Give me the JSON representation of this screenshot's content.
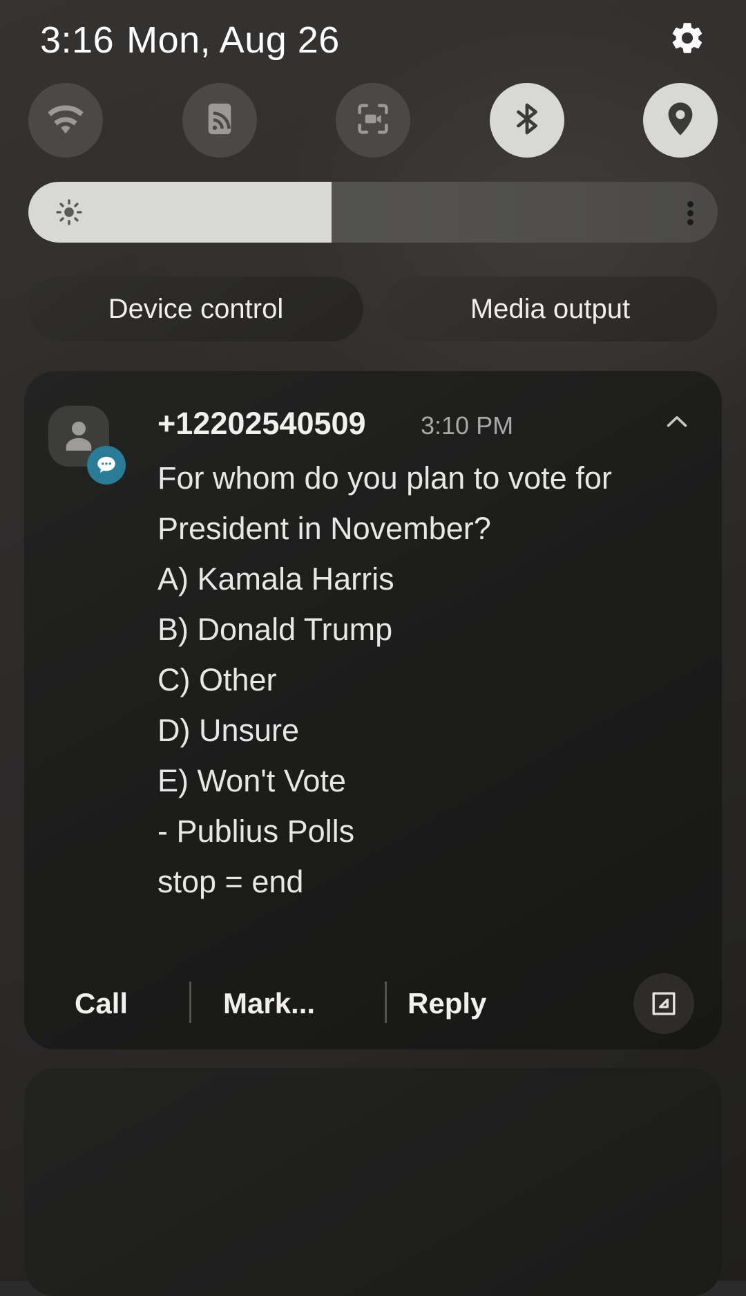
{
  "statusbar": {
    "time": "3:16",
    "date": "Mon, Aug 26",
    "settings_icon": "gear-icon"
  },
  "quick_settings": {
    "tiles": [
      {
        "name": "wifi",
        "icon": "wifi-icon",
        "state": "off"
      },
      {
        "name": "nfc",
        "icon": "nfc-icon",
        "state": "off"
      },
      {
        "name": "screencast",
        "icon": "screen-record-icon",
        "state": "off"
      },
      {
        "name": "bluetooth",
        "icon": "bluetooth-icon",
        "state": "on"
      },
      {
        "name": "location",
        "icon": "location-pin-icon",
        "state": "on"
      }
    ],
    "accent_on": "#d8d8d6",
    "accent_off": "#4a4947"
  },
  "brightness": {
    "icon": "brightness-icon",
    "value_percent": 44,
    "more_icon": "more-vertical-icon"
  },
  "shortcuts": {
    "device_control": "Device control",
    "media_output": "Media output"
  },
  "notification": {
    "avatar_icon": "person-avatar-icon",
    "badge_icon": "message-bubble-icon",
    "badge_color": "#2a7b96",
    "sender": "+12202540509",
    "timestamp": "3:10 PM",
    "collapse_icon": "chevron-up-icon",
    "message": "For whom do you plan to vote for President in November?\nA) Kamala Harris\nB) Donald Trump\nC) Other\nD) Unsure\nE) Won't Vote\n- Publius Polls\nstop = end",
    "message_lines": [
      "For whom do you plan",
      "to vote for President in",
      "November?",
      "A) Kamala Harris",
      "B) Donald Trump",
      "C) Other",
      "D) Unsure",
      "E) Won't Vote",
      "- Publius Polls",
      "stop = end"
    ],
    "actions": {
      "call": "Call",
      "mark": "Mark...",
      "reply": "Reply",
      "expand_icon": "open-in-new-icon"
    }
  }
}
